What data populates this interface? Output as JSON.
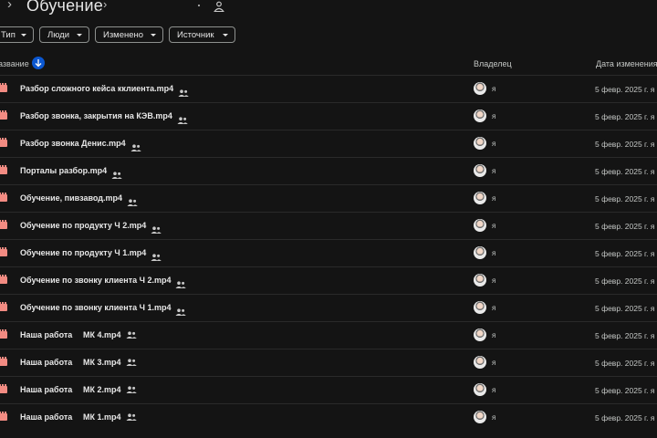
{
  "header": {
    "back_arrow": "›",
    "title": "Обучение",
    "breadcrumb_arrow": "›",
    "share_icon": "people-icon"
  },
  "filters": [
    {
      "label": "Тип"
    },
    {
      "label": "Люди"
    },
    {
      "label": "Изменено"
    },
    {
      "label": "Источник"
    }
  ],
  "columns": {
    "name": "азвание",
    "owner": "Владелец",
    "modified": "Дата изменения"
  },
  "colors": {
    "accent": "#0b57d0",
    "video_icon": "#f28b82",
    "background": "#141414"
  },
  "files": [
    {
      "name": "Разбор сложного кейса кклиента.mp4",
      "owner": "я",
      "date": "5 февр. 2025 г. я"
    },
    {
      "name": "Разбор звонка, закрытия на КЭВ.mp4",
      "owner": "я",
      "date": "5 февр. 2025 г. я"
    },
    {
      "name": "Разбор звонка Денис.mp4",
      "owner": "я",
      "date": "5 февр. 2025 г. я"
    },
    {
      "name": "Порталы разбор.mp4",
      "owner": "я",
      "date": "5 февр. 2025 г. я"
    },
    {
      "name": "Обучение, пивзавод.mp4",
      "owner": "я",
      "date": "5 февр. 2025 г. я"
    },
    {
      "name": "Обучение по продукту Ч 2.mp4",
      "owner": "я",
      "date": "5 февр. 2025 г. я"
    },
    {
      "name": "Обучение по продукту Ч 1.mp4",
      "owner": "я",
      "date": "5 февр. 2025 г. я"
    },
    {
      "name": "Обучение по звонку клиента Ч 2.mp4",
      "owner": "я",
      "date": "5 февр. 2025 г. я"
    },
    {
      "name": "Обучение по звонку клиента Ч 1.mp4",
      "owner": "я",
      "date": "5 февр. 2025 г. я"
    },
    {
      "name": "Наша работа",
      "name_b": "МК 4.mp4",
      "owner": "я",
      "date": "5 февр. 2025 г. я"
    },
    {
      "name": "Наша работа",
      "name_b": "МК 3.mp4",
      "owner": "я",
      "date": "5 февр. 2025 г. я"
    },
    {
      "name": "Наша работа",
      "name_b": "МК 2.mp4",
      "owner": "я",
      "date": "5 февр. 2025 г. я"
    },
    {
      "name": "Наша работа",
      "name_b": "МК 1.mp4",
      "owner": "я",
      "date": "5 февр. 2025 г. я"
    }
  ]
}
